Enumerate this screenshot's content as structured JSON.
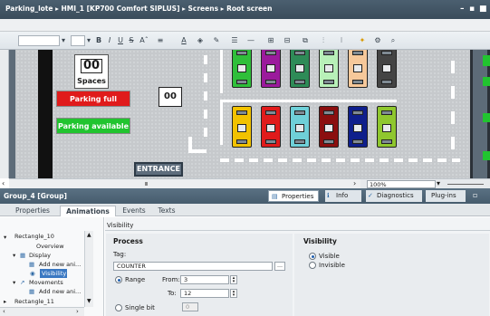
{
  "titlebar": {
    "breadcrumb": [
      "Parking_lote",
      "HMI_1 [KP700 Comfort SIPLUS]",
      "Screens",
      "Root screen"
    ],
    "separator": "▸"
  },
  "toolbar": {
    "bold": "B",
    "italic": "I",
    "underline": "U",
    "strike": "S",
    "font_size": "Aˆ"
  },
  "canvas": {
    "spaces_value": "00",
    "spaces_label": "Spaces",
    "counter_value": "00",
    "parking_full": "Parking full",
    "parking_available": "Parking available",
    "entrance": "ENTRANCE",
    "top_cars": [
      "#2fbf3a",
      "#9b1a9c",
      "#2e8b57",
      "#b8f0b8",
      "#f6c89a",
      "#444444"
    ],
    "bottom_cars": [
      "#f2c200",
      "#e01b1b",
      "#6fd0d8",
      "#8b0f0f",
      "#0f1f8c",
      "#8fc72e"
    ]
  },
  "zoom": "100%",
  "group": {
    "title": "Group_4 [Group]",
    "right_tabs": [
      "Properties",
      "Info",
      "Diagnostics",
      "Plug-ins"
    ]
  },
  "tabs": [
    "Properties",
    "Animations",
    "Events",
    "Texts"
  ],
  "tree": {
    "items": [
      "Rectangle_10",
      "Overview",
      "Display",
      "Add new ani...",
      "Visibility",
      "Movements",
      "Add new ani...",
      "Rectangle_11"
    ]
  },
  "visibility_panel": {
    "header": "Visibility",
    "process_title": "Process",
    "tag_label": "Tag:",
    "tag_value": "COUNTER",
    "range_label": "Range",
    "from_label": "From:",
    "from_value": "3",
    "to_label": "To:",
    "to_value": "12",
    "single_bit_label": "Single bit",
    "single_bit_value": "0",
    "visibility_title": "Visibility",
    "visible_label": "Visible",
    "invisible_label": "Invisible"
  }
}
